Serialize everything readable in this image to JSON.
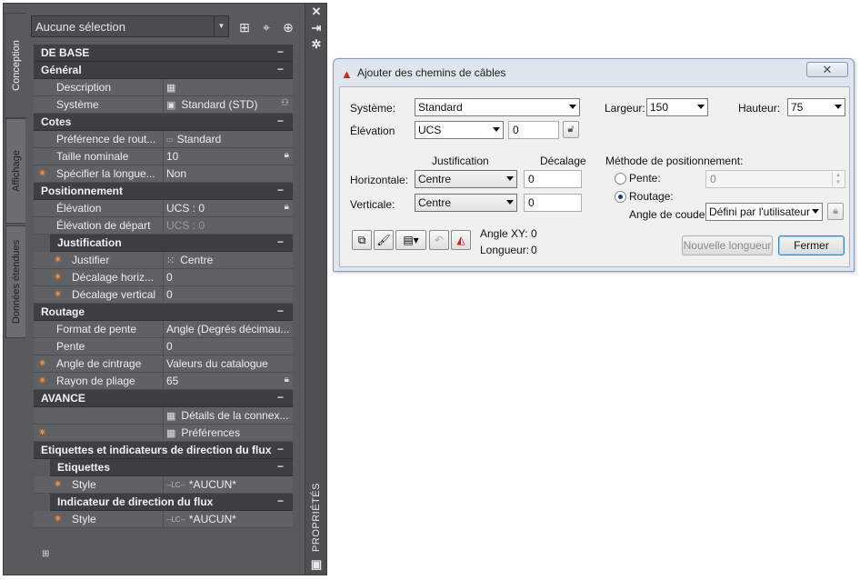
{
  "palette": {
    "tabs": [
      "Conception",
      "Affichage",
      "Données étendues"
    ],
    "selection": "Aucune sélection",
    "side_label": "PROPRIÉTÉS",
    "sections": {
      "base": "DE BASE",
      "general": "Général",
      "cotes": "Cotes",
      "positionnement": "Positionnement",
      "justification": "Justification",
      "routage": "Routage",
      "avance": "AVANCE",
      "etiq_ind": "Etiquettes et indicateurs de direction du flux",
      "etiquettes": "Etiquettes",
      "indicateur": "Indicateur de direction du flux"
    },
    "props": {
      "description": {
        "name": "Description",
        "value": ""
      },
      "systeme": {
        "name": "Système",
        "value": "Standard (STD)"
      },
      "pref_routage": {
        "name": "Préférence de rout...",
        "value": "Standard"
      },
      "taille": {
        "name": "Taille nominale",
        "value": "10"
      },
      "specifier": {
        "name": "Spécifier la longue...",
        "value": "Non"
      },
      "elevation": {
        "name": "Élévation",
        "value": "UCS : 0"
      },
      "elev_depart": {
        "name": "Élévation de départ",
        "value": "UCS : 0"
      },
      "justifier": {
        "name": "Justifier",
        "value": "Centre"
      },
      "decalage_h": {
        "name": "Décalage horiz...",
        "value": "0"
      },
      "decalage_v": {
        "name": "Décalage vertical",
        "value": "0"
      },
      "format_pente": {
        "name": "Format de pente",
        "value": "Angle (Degrés décimau..."
      },
      "pente": {
        "name": "Pente",
        "value": "0"
      },
      "angle_cintrage": {
        "name": "Angle de cintrage",
        "value": "Valeurs du catalogue"
      },
      "rayon": {
        "name": "Rayon de pliage",
        "value": "65"
      },
      "details": {
        "value": "Détails de la connex..."
      },
      "preferences": {
        "value": "Préférences"
      },
      "style_etiq": {
        "name": "Style",
        "value": "*AUCUN*"
      },
      "style_ind": {
        "name": "Style",
        "value": "*AUCUN*"
      }
    },
    "lc_icon": "--LC--"
  },
  "dialog": {
    "title": "Ajouter des chemins de câbles",
    "close": "✕",
    "systeme_label": "Système:",
    "systeme_value": "Standard",
    "elevation_label": "Élévation",
    "elevation_combo": "UCS",
    "elevation_value": "0",
    "largeur_label": "Largeur:",
    "largeur_value": "150",
    "hauteur_label": "Hauteur:",
    "hauteur_value": "75",
    "justification_header": "Justification",
    "decalage_header": "Décalage",
    "horizontale_label": "Horizontale:",
    "horizontale_value": "Centre",
    "horizontale_offset": "0",
    "verticale_label": "Verticale:",
    "verticale_value": "Centre",
    "verticale_offset": "0",
    "methode_label": "Méthode de positionnement:",
    "pente_label": "Pente:",
    "pente_value": "0",
    "routage_label": "Routage:",
    "angle_coude_label": "Angle de coude:",
    "angle_coude_value": "Défini par l'utilisateur",
    "angle_xy_label": "Angle XY:",
    "angle_xy_value": "0",
    "longueur_label": "Longueur:",
    "longueur_value": "0",
    "nouvelle_longueur": "Nouvelle longueur",
    "fermer": "Fermer"
  }
}
